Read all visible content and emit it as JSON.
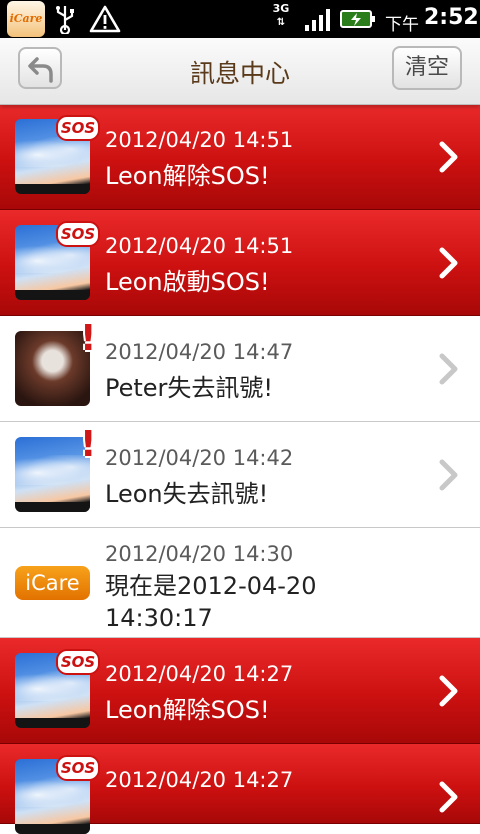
{
  "status_bar": {
    "app_icon_text": "iCare",
    "network": "3G",
    "ampm": "下午",
    "time": "2:52"
  },
  "header": {
    "title": "訊息中心",
    "clear_label": "清空"
  },
  "messages": [
    {
      "type": "sos",
      "avatar": "sky",
      "badge": "SOS",
      "date": "2012/04/20 14:51",
      "text": "Leon解除SOS!",
      "chevron": true
    },
    {
      "type": "sos",
      "avatar": "sky",
      "badge": "SOS",
      "date": "2012/04/20 14:51",
      "text": "Leon啟動SOS!",
      "chevron": true
    },
    {
      "type": "alert",
      "avatar": "photo",
      "badge": "!",
      "date": "2012/04/20 14:47",
      "text": "Peter失去訊號!",
      "chevron": true
    },
    {
      "type": "alert",
      "avatar": "sky",
      "badge": "!",
      "date": "2012/04/20 14:42",
      "text": "Leon失去訊號!",
      "chevron": true
    },
    {
      "type": "system",
      "avatar": "icare-logo",
      "logo_text": "iCare",
      "date": "2012/04/20 14:30",
      "text_lines": [
        "現在是2012-04-20",
        "14:30:17"
      ],
      "chevron": false
    },
    {
      "type": "sos",
      "avatar": "sky",
      "badge": "SOS",
      "date": "2012/04/20 14:27",
      "text": "Leon解除SOS!",
      "chevron": true
    },
    {
      "type": "sos",
      "avatar": "sky",
      "badge": "SOS",
      "date": "2012/04/20 14:27",
      "text": "",
      "chevron": true
    }
  ],
  "colors": {
    "sos_row": "#d11818",
    "title_text": "#5a3a1a",
    "chevron_white": "#ffffff",
    "chevron_grey": "#c8c8c8"
  }
}
